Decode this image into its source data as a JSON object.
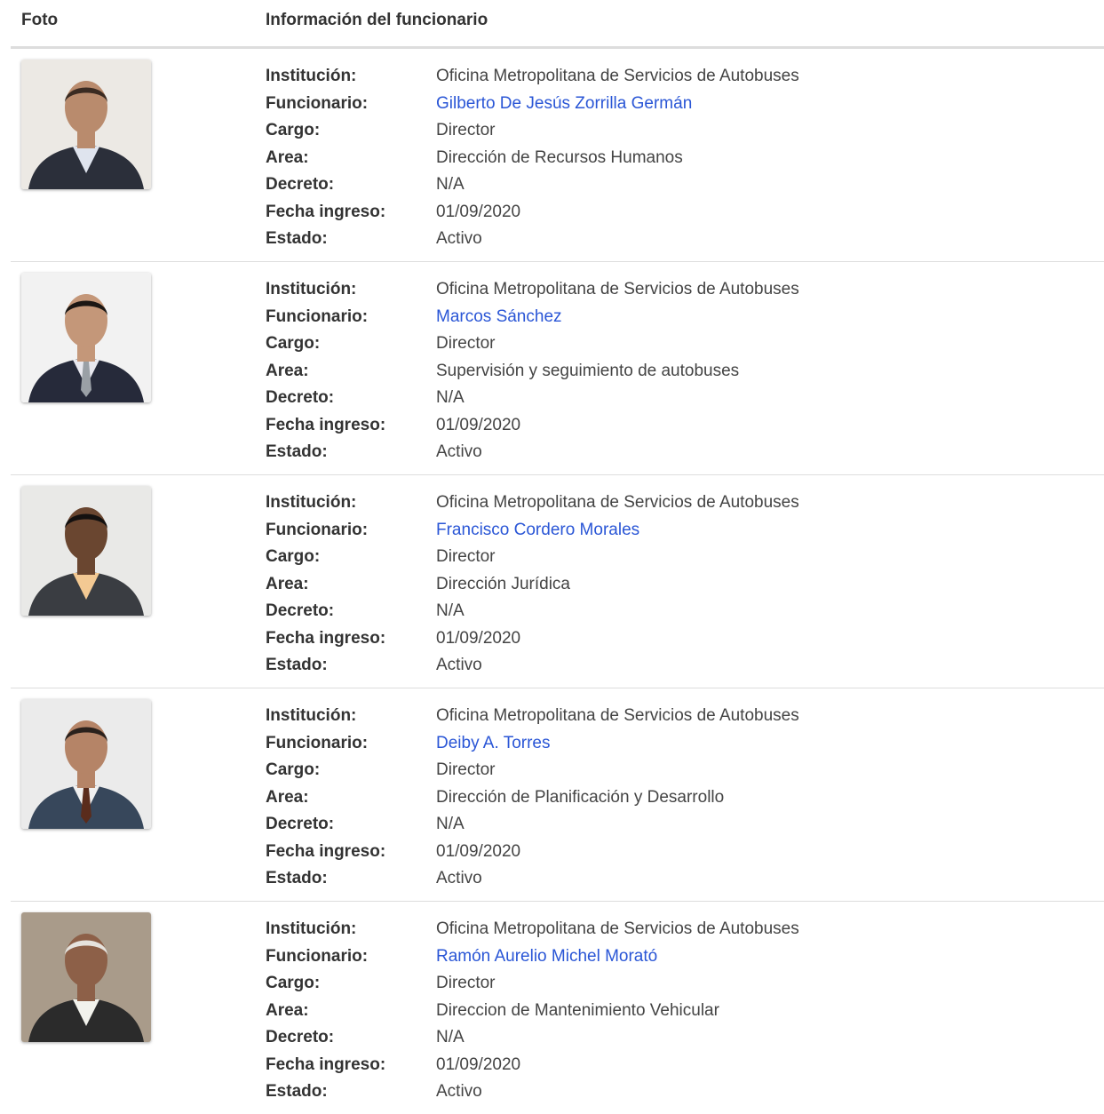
{
  "header": {
    "foto": "Foto",
    "info": "Información del funcionario"
  },
  "labels": {
    "institucion": "Institución:",
    "funcionario": "Funcionario:",
    "cargo": "Cargo:",
    "area": "Area:",
    "decreto": "Decreto:",
    "fecha": "Fecha ingreso:",
    "estado": "Estado:"
  },
  "colors": {
    "link": "#2a56d6",
    "divider": "#dddddd"
  },
  "rows": [
    {
      "institucion": "Oficina Metropolitana de Servicios de Autobuses",
      "funcionario": "Gilberto De Jesús Zorrilla Germán",
      "cargo": "Director",
      "area": "Dirección de Recursos Humanos",
      "decreto": "N/A",
      "fecha": "01/09/2020",
      "estado": "Activo"
    },
    {
      "institucion": "Oficina Metropolitana de Servicios de Autobuses",
      "funcionario": "Marcos Sánchez",
      "cargo": "Director",
      "area": "Supervisión y seguimiento de autobuses",
      "decreto": "N/A",
      "fecha": "01/09/2020",
      "estado": "Activo"
    },
    {
      "institucion": "Oficina Metropolitana de Servicios de Autobuses",
      "funcionario": "Francisco Cordero Morales",
      "cargo": "Director",
      "area": "Dirección Jurídica",
      "decreto": "N/A",
      "fecha": "01/09/2020",
      "estado": "Activo"
    },
    {
      "institucion": "Oficina Metropolitana de Servicios de Autobuses",
      "funcionario": "Deiby A. Torres",
      "cargo": "Director",
      "area": "Dirección de Planificación y Desarrollo",
      "decreto": "N/A",
      "fecha": "01/09/2020",
      "estado": "Activo"
    },
    {
      "institucion": "Oficina Metropolitana de Servicios de Autobuses",
      "funcionario": "Ramón Aurelio Michel Morató",
      "cargo": "Director",
      "area": "Direccion de Mantenimiento Vehicular",
      "decreto": "N/A",
      "fecha": "01/09/2020",
      "estado": "Activo"
    }
  ]
}
